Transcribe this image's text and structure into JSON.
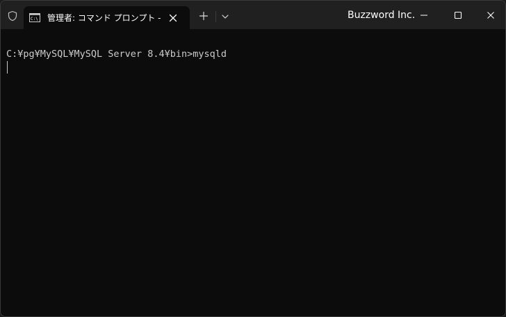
{
  "titlebar": {
    "tab_title": "管理者: コマンド プロンプト - mysqld",
    "org_name": "Buzzword Inc."
  },
  "terminal": {
    "lines": [
      "C:¥pg¥MySQL¥MySQL Server 8.4¥bin>mysqld"
    ]
  },
  "colors": {
    "titlebar_bg": "#202020",
    "terminal_bg": "#0c0c0c",
    "terminal_text": "#cccccc"
  },
  "icons": {
    "admin": "shield-icon",
    "tab": "command-prompt-icon",
    "close_tab": "close-icon",
    "new_tab": "plus-icon",
    "dropdown": "chevron-down-icon",
    "minimize": "minimize-icon",
    "maximize": "maximize-icon",
    "close_window": "close-icon"
  }
}
